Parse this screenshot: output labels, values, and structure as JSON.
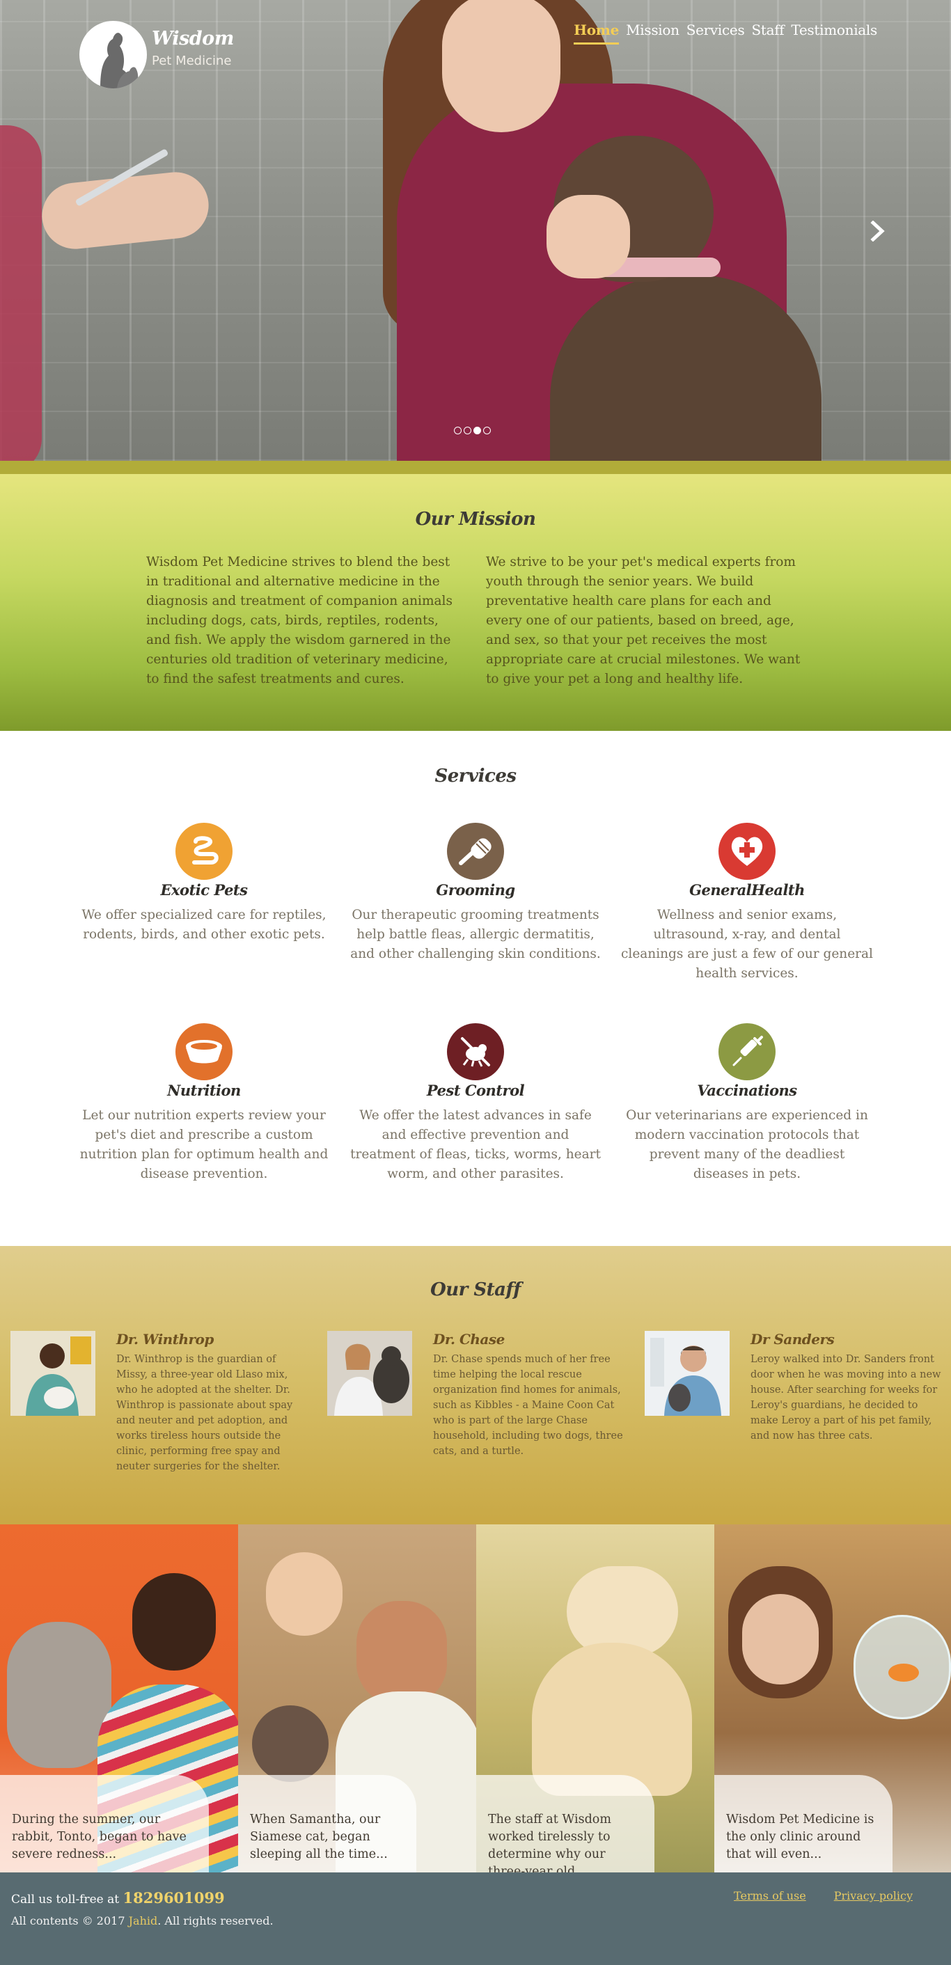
{
  "brand": {
    "name": "Wisdom",
    "tagline": "Pet Medicine"
  },
  "nav": {
    "items": [
      {
        "label": "Home",
        "active": true
      },
      {
        "label": "Mission",
        "active": false
      },
      {
        "label": "Services",
        "active": false
      },
      {
        "label": "Staff",
        "active": false
      },
      {
        "label": "Testimonials",
        "active": false
      }
    ]
  },
  "hero": {
    "next_icon": "chevron-right-icon",
    "slide_count": 4,
    "active_slide": 3
  },
  "mission": {
    "title": "Our Mission",
    "paragraphs": [
      "Wisdom Pet Medicine strives to blend the best in traditional and alternative medicine in the diagnosis and treatment of companion animals including dogs, cats, birds, reptiles, rodents, and fish. We apply the wisdom garnered in the centuries old tradition of veterinary medicine, to find the safest treatments and cures.",
      "We strive to be your pet's medical experts from youth through the senior years. We build preventative health care plans for each and every one of our patients, based on breed, age, and sex, so that your pet receives the most appropriate care at crucial milestones. We want to give your pet a long and healthy life."
    ]
  },
  "services": {
    "title": "Services",
    "items": [
      {
        "title": "Exotic Pets",
        "icon": "snake-icon",
        "color": "#f0a233",
        "description": "We offer specialized care for reptiles, rodents, birds, and other exotic pets."
      },
      {
        "title": "Grooming",
        "icon": "brush-icon",
        "color": "#7a614a",
        "description": "Our therapeutic grooming treatments help battle fleas, allergic dermatitis, and other challenging skin conditions."
      },
      {
        "title": "GeneralHealth",
        "icon": "heart-cross-icon",
        "color": "#d93a32",
        "description": "Wellness and senior exams, ultrasound, x-ray, and dental cleanings are just a few of our general health services."
      },
      {
        "title": "Nutrition",
        "icon": "food-bowl-icon",
        "color": "#e2712b",
        "description": "Let our nutrition experts review your pet's diet and prescribe a custom nutrition plan for optimum health and disease prevention."
      },
      {
        "title": "Pest Control",
        "icon": "no-bug-icon",
        "color": "#6e1f24",
        "description": "We offer the latest advances in safe and effective prevention and treatment of fleas, ticks, worms, heart worm, and other parasites."
      },
      {
        "title": "Vaccinations",
        "icon": "syringe-icon",
        "color": "#8c9a43",
        "description": "Our veterinarians are experienced in modern vaccination protocols that prevent many of the deadliest diseases in pets."
      }
    ]
  },
  "staff": {
    "title": "Our Staff",
    "members": [
      {
        "name": "Dr. Winthrop",
        "bio": "Dr. Winthrop is the guardian of Missy, a three-year old Llaso mix, who he adopted at the shelter. Dr. Winthrop is passionate about spay and neuter and pet adoption, and works tireless hours outside the clinic, performing free spay and neuter surgeries for the shelter."
      },
      {
        "name": "Dr. Chase",
        "bio": "Dr. Chase spends much of her free time helping the local rescue organization find homes for animals, such as Kibbles - a Maine Coon Cat who is part of the large Chase household, including two dogs, three cats, and a turtle."
      },
      {
        "name": "Dr Sanders",
        "bio": "Leroy walked into Dr. Sanders front door when he was moving into a new house. After searching for weeks for Leroy's guardians, he decided to make Leroy a part of his pet family, and now has three cats."
      }
    ]
  },
  "testimonials": {
    "items": [
      {
        "text": "During the summer, our rabbit, Tonto, began to have severe redness..."
      },
      {
        "text": "When Samantha, our Siamese cat, began sleeping all the time..."
      },
      {
        "text": "The staff at Wisdom worked tirelessly to determine why our three-year old..."
      },
      {
        "text": "Wisdom Pet Medicine is the only clinic around that will even..."
      }
    ]
  },
  "footer": {
    "call_label": "Call us toll-free at",
    "phone": "1829601099",
    "copyright_prefix": "All contents © 2017",
    "author": "Jahid",
    "copyright_suffix": ". All rights reserved.",
    "links": [
      "Terms of use",
      "Privacy policy"
    ]
  }
}
